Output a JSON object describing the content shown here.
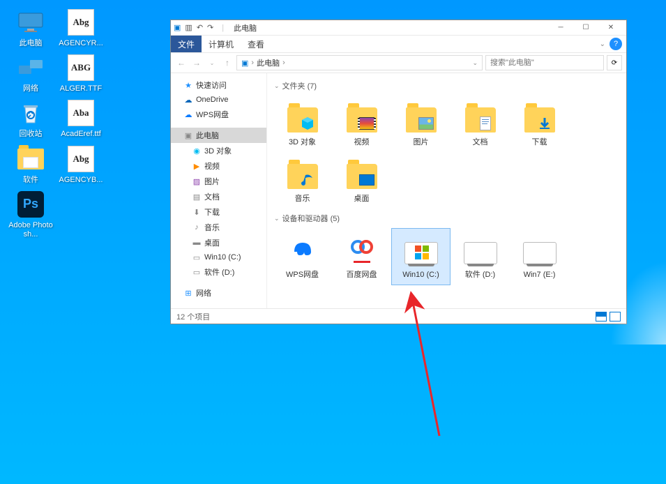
{
  "desktop_icons": [
    {
      "label": "此电脑",
      "kind": "pc"
    },
    {
      "label": "AGENCYR...",
      "kind": "font",
      "glyph": "Abg"
    },
    {
      "label": "网络",
      "kind": "network"
    },
    {
      "label": "ALGER.TTF",
      "kind": "font",
      "glyph": "ABG"
    },
    {
      "label": "回收站",
      "kind": "recycle"
    },
    {
      "label": "AcadEref.ttf",
      "kind": "font",
      "glyph": "Aba"
    },
    {
      "label": "软件",
      "kind": "folder"
    },
    {
      "label": "AGENCYB...",
      "kind": "font",
      "glyph": "Abg"
    },
    {
      "label": "Adobe Photosh...",
      "kind": "ps"
    }
  ],
  "window": {
    "title": "此电脑",
    "ribbon": {
      "file": "文件",
      "computer": "计算机",
      "view": "查看"
    },
    "nav": {
      "back": "←",
      "fwd": "→",
      "up": "↑"
    },
    "path_item": "此电脑",
    "path_arrow": "›",
    "search_placeholder": "搜索\"此电脑\"",
    "nav_pane": [
      {
        "label": "快速访问",
        "icon": "star",
        "color": "#1e90ff"
      },
      {
        "label": "OneDrive",
        "icon": "cloud",
        "color": "#0364b8"
      },
      {
        "label": "WPS网盘",
        "icon": "cloud",
        "color": "#0b7bff"
      },
      {
        "gap": true
      },
      {
        "label": "此电脑",
        "icon": "pc",
        "color": "#888",
        "active": true
      },
      {
        "label": "3D 对象",
        "icon": "cube",
        "color": "#00bcf2",
        "sub": true
      },
      {
        "label": "视频",
        "icon": "video",
        "color": "#ff8c00",
        "sub": true
      },
      {
        "label": "图片",
        "icon": "image",
        "color": "#8e44ad",
        "sub": true
      },
      {
        "label": "文档",
        "icon": "doc",
        "color": "#888",
        "sub": true
      },
      {
        "label": "下载",
        "icon": "download",
        "color": "#888",
        "sub": true
      },
      {
        "label": "音乐",
        "icon": "music",
        "color": "#888",
        "sub": true
      },
      {
        "label": "桌面",
        "icon": "desktop",
        "color": "#888",
        "sub": true
      },
      {
        "label": "Win10 (C:)",
        "icon": "drive",
        "color": "#888",
        "sub": true
      },
      {
        "label": "软件 (D:)",
        "icon": "drive",
        "color": "#888",
        "sub": true
      },
      {
        "gap": true
      },
      {
        "label": "网络",
        "icon": "network",
        "color": "#1e90ff"
      }
    ],
    "groups": [
      {
        "title": "文件夹 (7)",
        "items": [
          {
            "label": "3D 对象",
            "icon": "cube"
          },
          {
            "label": "视频",
            "icon": "video"
          },
          {
            "label": "图片",
            "icon": "image"
          },
          {
            "label": "文档",
            "icon": "doc"
          },
          {
            "label": "下载",
            "icon": "download"
          },
          {
            "label": "音乐",
            "icon": "music"
          },
          {
            "label": "桌面",
            "icon": "desktop"
          }
        ]
      },
      {
        "title": "设备和驱动器 (5)",
        "items": [
          {
            "label": "WPS网盘",
            "icon": "wps"
          },
          {
            "label": "百度网盘",
            "icon": "baidu"
          },
          {
            "label": "Win10 (C:)",
            "icon": "win-drive",
            "selected": true
          },
          {
            "label": "软件 (D:)",
            "icon": "drive"
          },
          {
            "label": "Win7 (E:)",
            "icon": "drive"
          }
        ]
      }
    ],
    "status": "12 个项目"
  },
  "colors": {
    "accent": "#0078d4",
    "folder": "#ffd35a",
    "arrow": "#e8262a"
  }
}
